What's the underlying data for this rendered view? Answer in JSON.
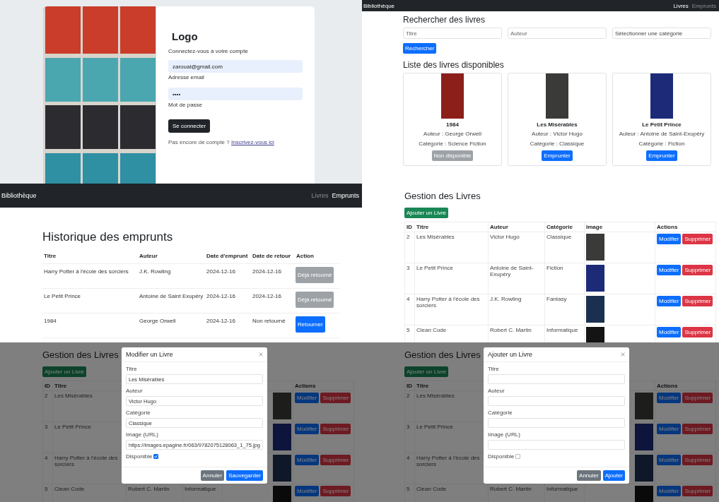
{
  "login": {
    "logo": "Logo",
    "subtitle": "Connectez-vous à votre compte",
    "email": {
      "value": "zaroual@gmail.com",
      "label": "Adresse email"
    },
    "password": {
      "value": "••••",
      "label": "Mot de passe"
    },
    "submit": "Se connecter",
    "footer_text": "Pas encore de compte ?",
    "footer_link": "Inscrivez-vous ici"
  },
  "catalog": {
    "navbar": {
      "brand": "Bibliothèque",
      "links": [
        {
          "label": "Livres",
          "selected": true
        },
        {
          "label": "Emprunts",
          "selected": false
        }
      ]
    },
    "search": {
      "title": "Rechercher des livres",
      "fields": [
        {
          "kind": "input",
          "placeholder": "Titre"
        },
        {
          "kind": "input",
          "placeholder": "Auteur"
        },
        {
          "kind": "select",
          "placeholder": "Sélectionner une catégorie"
        }
      ],
      "button": "Rechercher"
    },
    "list": {
      "title": "Liste des livres disponibles",
      "books": [
        {
          "title": "1984",
          "author": "Auteur : George Orwell",
          "category": "Catégorie : Science Fiction",
          "available": false,
          "button": "Non disponible",
          "color": "#8c1f1a"
        },
        {
          "title": "Les Misérables",
          "author": "Auteur : Victor Hugo",
          "category": "Catégorie : Classique",
          "available": true,
          "button": "Emprunter",
          "color": "#3a3a38"
        },
        {
          "title": "Le Petit Prince",
          "author": "Auteur : Antoine de Saint-Exupéry",
          "category": "Catégorie : Fiction",
          "available": true,
          "button": "Emprunter",
          "color": "#1c2a78"
        }
      ]
    }
  },
  "loans": {
    "navbar": {
      "brand": "Bibliothèque",
      "links": [
        {
          "label": "Livres",
          "selected": false
        },
        {
          "label": "Emprunts",
          "selected": true
        }
      ]
    },
    "title": "Historique des emprunts",
    "columns": [
      "Titre",
      "Auteur",
      "Date d'emprunt",
      "Date de retour",
      "Action"
    ],
    "rows": [
      {
        "title": "Harry Potter à l'école des sorciers",
        "author": "J.K. Rowling",
        "loan_date": "2024-12-16",
        "return_date": "2024-12-16",
        "returned": true,
        "action": "Déjà retourné"
      },
      {
        "title": "Le Petit Prince",
        "author": "Antoine de Saint Exupéry",
        "loan_date": "2024-12-16",
        "return_date": "2024-12-16",
        "returned": true,
        "action": "Déjà retourné"
      },
      {
        "title": "1984",
        "author": "George Orwell",
        "loan_date": "2024-12-16",
        "return_date": "Non retourné",
        "returned": false,
        "action": "Retourner"
      }
    ]
  },
  "admin": {
    "title": "Gestion des Livres",
    "add_button": "Ajouter un Livre",
    "columns": [
      "ID",
      "Titre",
      "Auteur",
      "Catégorie",
      "Image",
      "Actions"
    ],
    "rows": [
      {
        "id": "2",
        "title": "Les Misérables",
        "author": "Victor Hugo",
        "category": "Classique",
        "color": "#3a3a38",
        "edit": "Modifier",
        "delete": "Supprimer"
      },
      {
        "id": "3",
        "title": "Le Petit Prince",
        "author": "Antoine de Saint-Exupéry",
        "category": "Fiction",
        "color": "#1c2a78",
        "edit": "Modifier",
        "delete": "Supprimer"
      },
      {
        "id": "4",
        "title": "Harry Potter à l'école des sorciers",
        "author": "J.K. Rowling",
        "category": "Fantasy",
        "color": "#1b3050",
        "edit": "Modifier",
        "delete": "Supprimer"
      },
      {
        "id": "5",
        "title": "Clean Code",
        "author": "Robert C. Martin",
        "category": "Informatique",
        "color": "#141414",
        "edit": "Modifier",
        "delete": "Supprimer"
      }
    ]
  },
  "edit_dialog": {
    "background": {
      "title": "Gestion des Livres",
      "add_button": "Ajouter un Livre",
      "columns": [
        "ID",
        "Titre",
        null,
        null,
        null,
        "Actions"
      ],
      "rows": [
        {
          "id": "2",
          "title": "Les Misérables",
          "color": "#1d1d1c",
          "edit": "Modifier",
          "delete": "Supprimer"
        },
        {
          "id": "3",
          "title": "Le Petit Prince",
          "color": "#0e153c",
          "edit": "Modifier",
          "delete": "Supprimer"
        },
        {
          "id": "4",
          "title": "Harry Potter à l'école des sorciers",
          "color": "#0e1828",
          "edit": "Modifier",
          "delete": "Supprimer"
        },
        {
          "id": "5",
          "title": "Clean Code",
          "author": "Robert C. Martin",
          "category": "Informatique",
          "color": "#0a0a0a",
          "edit": "Modifier",
          "delete": "Supprimer"
        }
      ]
    },
    "dialog": {
      "title": "Modifier un Livre",
      "fields": [
        {
          "label": "Titre",
          "value": "Les Misérables"
        },
        {
          "label": "Auteur",
          "value": "Victor Hugo"
        },
        {
          "label": "Catégorie",
          "value": "Classique"
        },
        {
          "label": "Image (URL)",
          "value": "https://images.epagine.fr/063/9782075128063_1_75.jpg"
        }
      ],
      "available_label": "Disponible",
      "available": true,
      "cancel": "Annuler",
      "confirm": "Sauvegarder"
    }
  },
  "add_dialog": {
    "background": {
      "title": "Gestion des Livres",
      "add_button": "Ajouter un Livre",
      "columns": [
        "ID",
        "Titre",
        null,
        null,
        null,
        "Actions"
      ],
      "rows": [
        {
          "id": "2",
          "title": "Les Misérables",
          "color": "#1d1d1c",
          "edit": "Modifier",
          "delete": "Supprimer"
        },
        {
          "id": "3",
          "title": "Le Petit Prince",
          "color": "#0e153c",
          "edit": "Modifier",
          "delete": "Supprimer"
        },
        {
          "id": "4",
          "title": "Harry Potter à l'école des sorciers",
          "color": "#0e1828",
          "edit": "Modifier",
          "delete": "Supprimer"
        },
        {
          "id": "5",
          "title": "Clean Code",
          "author": "Robert C. Martin",
          "category": "Informatique",
          "color": "#0a0a0a",
          "edit": "Modifier",
          "delete": "Supprimer"
        }
      ]
    },
    "dialog": {
      "title": "Ajouter un Livre",
      "fields": [
        {
          "label": "Titre"
        },
        {
          "label": "Auteur"
        },
        {
          "label": "Catégorie"
        },
        {
          "label": "Image (URL)"
        }
      ],
      "available_label": "Disponible",
      "available": false,
      "cancel": "Annuler",
      "confirm": "Ajouter"
    }
  }
}
